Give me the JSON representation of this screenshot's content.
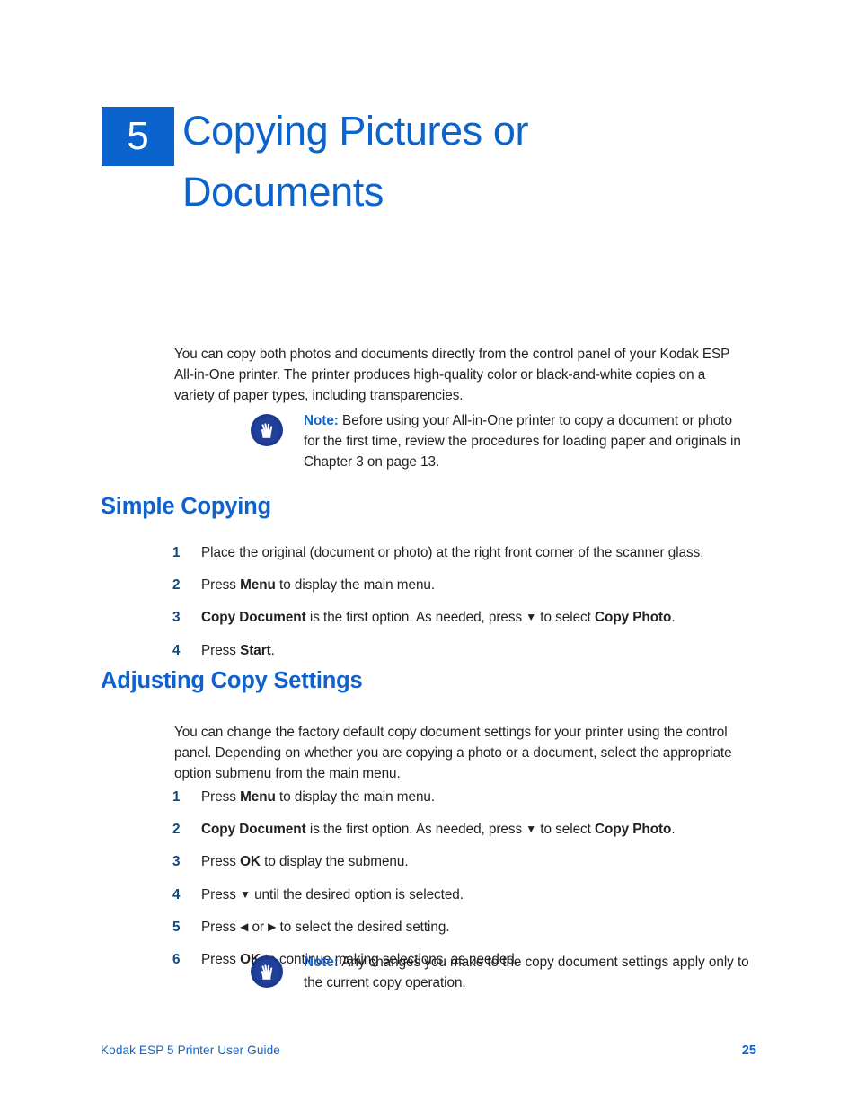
{
  "chapter": {
    "number": "5",
    "title_line_1": "Copying Pictures or",
    "title_line_2": "Documents",
    "accent_color": "#0b63ce"
  },
  "intro_paragraph": "You can copy both photos  and documents directly from the control panel of your Kodak ESP All-in-One printer. The printer produces high-quality color or black-and-white copies on a variety of paper types, including transparencies.",
  "notes": [
    {
      "icon": "hand-note-icon",
      "label": "Note:",
      "text": "Before using your All-in-One printer to copy a document or photo for the first time, review the procedures for loading paper and originals in Chapter 3 on page 13."
    },
    {
      "icon": "hand-note-icon",
      "label": "Note:",
      "text": "Any changes you make to the copy document settings apply only to the current copy operation."
    }
  ],
  "sections": [
    {
      "heading": "Simple Copying",
      "steps": [
        {
          "number": "1",
          "parts": [
            {
              "type": "text",
              "value": "Place the original (document or photo) at the right front corner of the scanner glass."
            }
          ]
        },
        {
          "number": "2",
          "parts": [
            {
              "type": "text",
              "value": "Press "
            },
            {
              "type": "bold",
              "value": "Menu"
            },
            {
              "type": "text",
              "value": " to display the main menu."
            }
          ]
        },
        {
          "number": "3",
          "parts": [
            {
              "type": "bold",
              "value": "Copy Document"
            },
            {
              "type": "text",
              "value": " is the first option. As needed, press "
            },
            {
              "type": "arrow",
              "value": "▼"
            },
            {
              "type": "text",
              "value": " to select "
            },
            {
              "type": "bold",
              "value": "Copy Photo"
            },
            {
              "type": "text",
              "value": "."
            }
          ]
        },
        {
          "number": "4",
          "parts": [
            {
              "type": "text",
              "value": "Press "
            },
            {
              "type": "bold",
              "value": "Start"
            },
            {
              "type": "text",
              "value": "."
            }
          ]
        }
      ]
    },
    {
      "heading": "Adjusting Copy Settings",
      "paragraph": "You can change the factory default copy document settings for your printer using the control panel. Depending on whether you are copying a photo or a document, select the appropriate option submenu from the main menu.",
      "steps": [
        {
          "number": "1",
          "parts": [
            {
              "type": "text",
              "value": "Press "
            },
            {
              "type": "bold",
              "value": "Menu"
            },
            {
              "type": "text",
              "value": " to display the main menu."
            }
          ]
        },
        {
          "number": "2",
          "parts": [
            {
              "type": "bold",
              "value": "Copy Document"
            },
            {
              "type": "text",
              "value": " is the first option. As needed, press "
            },
            {
              "type": "arrow",
              "value": "▼"
            },
            {
              "type": "text",
              "value": " to select "
            },
            {
              "type": "bold",
              "value": "Copy Photo"
            },
            {
              "type": "text",
              "value": "."
            }
          ]
        },
        {
          "number": "3",
          "parts": [
            {
              "type": "text",
              "value": "Press "
            },
            {
              "type": "bold",
              "value": "OK"
            },
            {
              "type": "text",
              "value": " to display the submenu."
            }
          ]
        },
        {
          "number": "4",
          "parts": [
            {
              "type": "text",
              "value": "Press "
            },
            {
              "type": "arrow",
              "value": "▼"
            },
            {
              "type": "text",
              "value": " until the desired option is selected."
            }
          ]
        },
        {
          "number": "5",
          "parts": [
            {
              "type": "text",
              "value": "Press "
            },
            {
              "type": "arrow",
              "value": "◀"
            },
            {
              "type": "text",
              "value": " or "
            },
            {
              "type": "arrow",
              "value": "▶"
            },
            {
              "type": "text",
              "value": " to select the desired setting."
            }
          ]
        },
        {
          "number": "6",
          "parts": [
            {
              "type": "text",
              "value": "Press "
            },
            {
              "type": "bold",
              "value": "OK"
            },
            {
              "type": "text",
              "value": " to continue making selections, as needed."
            }
          ]
        }
      ]
    }
  ],
  "footer": {
    "guide_title": "Kodak ESP 5 Printer User Guide",
    "page_number": "25"
  }
}
